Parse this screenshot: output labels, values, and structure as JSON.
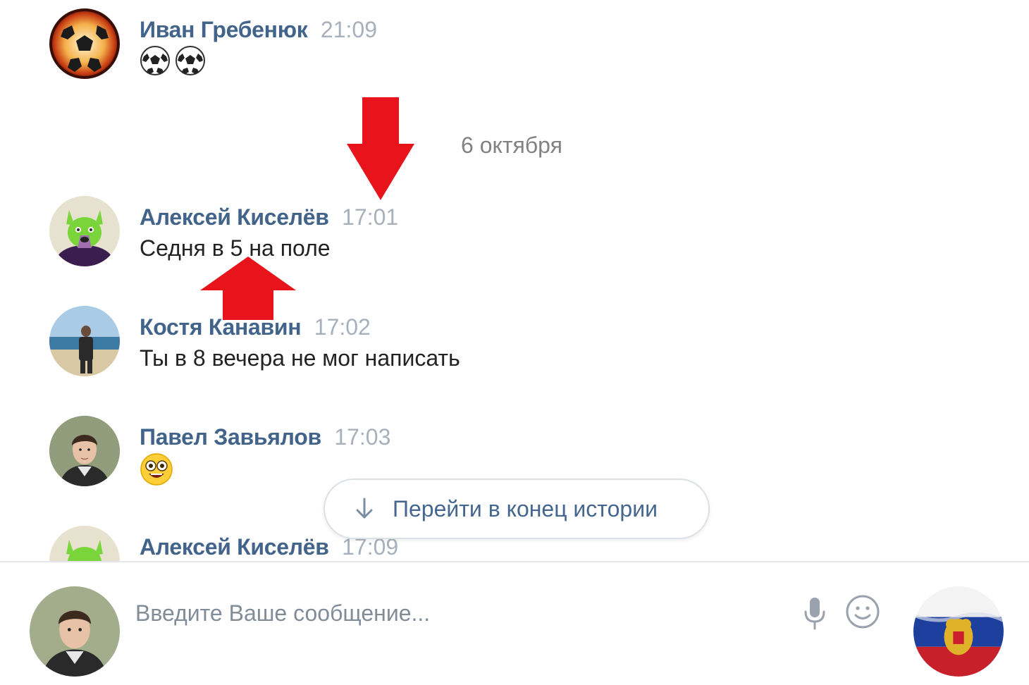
{
  "messages": [
    {
      "author": "Иван Гребенюк",
      "time": "21:09",
      "text": "",
      "emoji": [
        "soccer-ball",
        "soccer-ball"
      ]
    },
    {
      "author": "Алексей Киселёв",
      "time": "17:01",
      "text": "Седня в 5 на поле"
    },
    {
      "author": "Костя Канавин",
      "time": "17:02",
      "text": "Ты в 8 вечера не мог написать"
    },
    {
      "author": "Павел Завьялов",
      "time": "17:03",
      "text": "",
      "emoji": [
        "astonished-face"
      ]
    },
    {
      "author": "Алексей Киселёв",
      "time": "17:09",
      "text": ""
    }
  ],
  "date_separator": "6 октября",
  "jump_button": {
    "label": "Перейти в конец истории",
    "icon": "arrow-down-icon"
  },
  "composer": {
    "placeholder": "Введите Ваше сообщение...",
    "icons": [
      "mic-icon",
      "smile-icon"
    ]
  },
  "annotations": {
    "arrow_color": "#e8141c"
  },
  "colors": {
    "author": "#42648b",
    "time": "#a8b1bb",
    "text": "#222222",
    "accent": "#45678f"
  }
}
